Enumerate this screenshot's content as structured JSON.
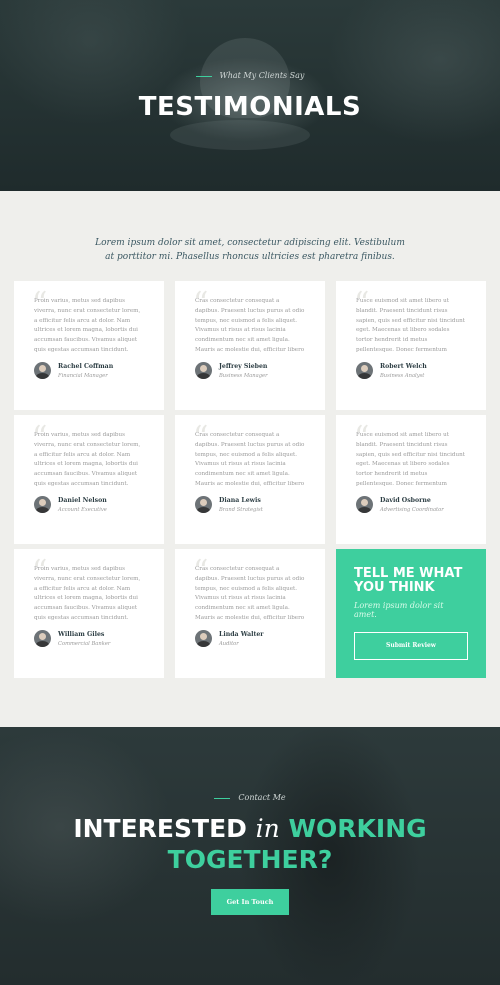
{
  "hero": {
    "eyebrow": "What My Clients Say",
    "title": "TESTIMONIALS"
  },
  "intro": {
    "text": "Lorem ipsum dolor sit amet, consectetur adipiscing elit. Vestibulum at porttitor mi. Phasellus rhoncus ultricies est pharetra finibus."
  },
  "testimonials": [
    {
      "text": "Proin varius, metus sed dapibus viverra, nunc erat consectetur lorem, a efficitur felis arcu at dolor. Nam ultrices et lorem magna, lobortis dui accumsan faucibus. Vivamus aliquet quis egestas accumsan tincidunt. Proin nec auctor lacus.",
      "name": "Rachel Coffman",
      "role": "Financial Manager"
    },
    {
      "text": "Cras consectetur consequat a dapibus. Praesent luctus purus at odio tempus, nec euismod a felis aliquet. Vivamus ut risus at risus lacinia condimentum nec sit amet ligula. Mauris ac molestie dui, efficitur libero velit facilisis.",
      "name": "Jeffrey Sieben",
      "role": "Business Manager"
    },
    {
      "text": "Fusce euismod sit amet libero ut blandit. Praesent tincidunt risus sapien, quis sed efficitur nisi tincidunt eget. Maecenas ut libero sodales tortor hendrerit id metus pellentesque. Donec fermentum magna, sit amet faucibus velit felis eget.",
      "name": "Robert Welch",
      "role": "Business Analyst"
    },
    {
      "text": "Proin varius, metus sed dapibus viverra, nunc erat consectetur lorem, a efficitur felis arcu at dolor. Nam ultrices et lorem magna, lobortis dui accumsan faucibus. Vivamus aliquet quis egestas accumsan tincidunt. Proin nec auctor lacus.",
      "name": "Daniel Nelson",
      "role": "Account Executive"
    },
    {
      "text": "Cras consectetur consequat a dapibus. Praesent luctus purus at odio tempus, nec euismod a felis aliquet. Vivamus ut risus at risus lacinia condimentum nec sit amet ligula. Mauris ac molestie dui, efficitur libero velit facilisis.",
      "name": "Diana Lewis",
      "role": "Brand Strategist"
    },
    {
      "text": "Fusce euismod sit amet libero ut blandit. Praesent tincidunt risus sapien, quis sed efficitur nisi tincidunt eget. Maecenas ut libero sodales tortor hendrerit id metus pellentesque. Donec fermentum magna, sit amet faucibus velit felis eget.",
      "name": "David Osborne",
      "role": "Advertising Coordinator"
    },
    {
      "text": "Proin varius, metus sed dapibus viverra, nunc erat consectetur lorem, a efficitur felis arcu at dolor. Nam ultrices et lorem magna, lobortis dui accumsan faucibus. Vivamus aliquet quis egestas accumsan tincidunt. Proin nec auctor lacus.",
      "name": "William Giles",
      "role": "Commercial Banker"
    },
    {
      "text": "Cras consectetur consequat a dapibus. Praesent luctus purus at odio tempus, nec euismod a felis aliquet. Vivamus ut risus at risus lacinia condimentum nec sit amet ligula. Mauris ac molestie dui, efficitur libero velit facilisis.",
      "name": "Linda Walter",
      "role": "Auditor"
    }
  ],
  "cta": {
    "title": "TELL ME WHAT YOU THINK",
    "subtitle": "Lorem ipsum dolor sit amet.",
    "button": "Submit Review"
  },
  "contact": {
    "eyebrow": "Contact Me",
    "title_part1": "INTERESTED",
    "title_part2": "in",
    "title_part3": "WORKING",
    "title_part4": "TOGETHER?",
    "button": "Get In Touch"
  },
  "colors": {
    "accent": "#3ecf9e",
    "dark": "#2d3e44",
    "background": "#efefec"
  }
}
